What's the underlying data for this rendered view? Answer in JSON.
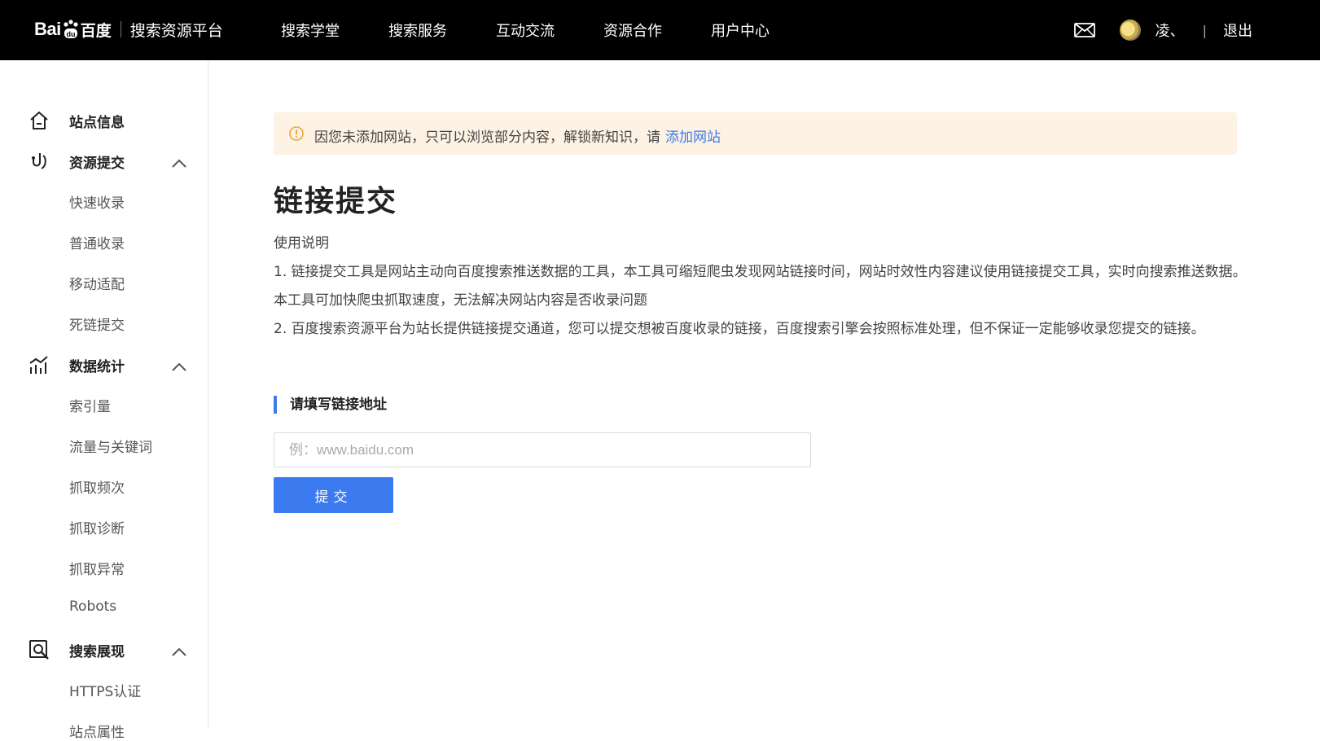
{
  "header": {
    "logo_text": "Bai",
    "logo_cn": "百度",
    "platform": "搜索资源平台",
    "nav": [
      "搜索学堂",
      "搜索服务",
      "互动交流",
      "资源合作",
      "用户中心"
    ],
    "username": "凌、",
    "separator": "|",
    "logout": "退出"
  },
  "sidebar": {
    "groups": [
      {
        "label": "站点信息",
        "icon": "home-icon",
        "items": []
      },
      {
        "label": "资源提交",
        "icon": "submit-icon",
        "items": [
          "快速收录",
          "普通收录",
          "移动适配",
          "死链提交"
        ]
      },
      {
        "label": "数据统计",
        "icon": "chart-icon",
        "items": [
          "索引量",
          "流量与关键词",
          "抓取频次",
          "抓取诊断",
          "抓取异常",
          "Robots"
        ]
      },
      {
        "label": "搜索展现",
        "icon": "search-display-icon",
        "items": [
          "HTTPS认证",
          "站点属性"
        ]
      }
    ]
  },
  "notice": {
    "text": "因您未添加网站，只可以浏览部分内容，解锁新知识，请",
    "link": "添加网站"
  },
  "main": {
    "title": "链接提交",
    "usage_title": "使用说明",
    "usage_1": "1. 链接提交工具是网站主动向百度搜索推送数据的工具，本工具可缩短爬虫发现网站链接时间，网站时效性内容建议使用链接提交工具，实时向搜索推送数据。本工具可加快爬虫抓取速度，无法解决网站内容是否收录问题",
    "usage_2": "2. 百度搜索资源平台为站长提供链接提交通道，您可以提交想被百度收录的链接，百度搜索引擎会按照标准处理，但不保证一定能够收录您提交的链接。",
    "section_title": "请填写链接地址",
    "input_placeholder": "例：www.baidu.com",
    "input_value": "",
    "submit_label": "提交"
  },
  "colors": {
    "accent": "#3b7bef",
    "notice_bg": "#fdf2e3",
    "topbar": "#000000"
  }
}
